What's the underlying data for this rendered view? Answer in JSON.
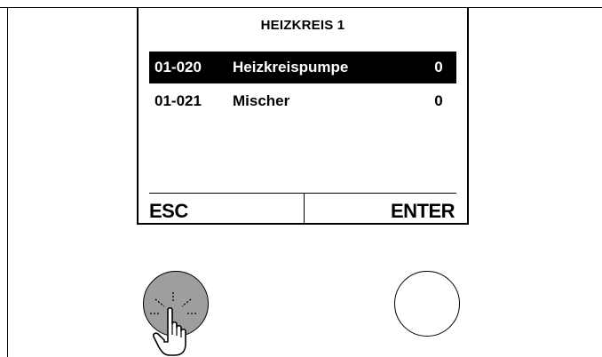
{
  "screen": {
    "title": "HEIZKREIS 1",
    "menu_items": [
      {
        "code": "01-020",
        "label": "Heizkreispumpe",
        "value": "0",
        "selected": true
      },
      {
        "code": "01-021",
        "label": "Mischer",
        "value": "0",
        "selected": false
      }
    ]
  },
  "softkeys": {
    "left_label": "ESC",
    "right_label": "ENTER"
  },
  "icons": {
    "press_indicator": "hand-press-icon"
  },
  "colors": {
    "highlight_bg": "#000000",
    "highlight_text": "#ffffff",
    "pressed_button": "#9e9e9e"
  }
}
